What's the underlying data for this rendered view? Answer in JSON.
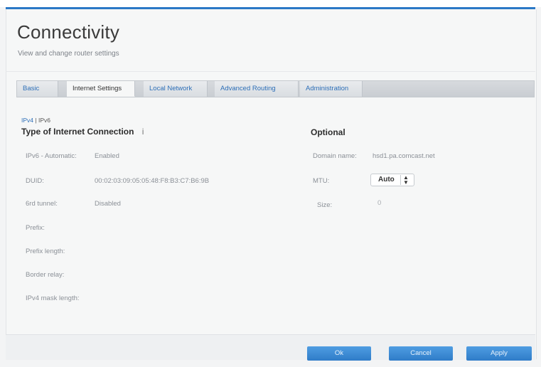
{
  "header": {
    "title": "Connectivity",
    "subtitle": "View and change router settings"
  },
  "tabs": [
    {
      "label": "Basic",
      "active": false
    },
    {
      "label": "Internet Settings",
      "active": true
    },
    {
      "label": "Local Network",
      "active": false
    },
    {
      "label": "Advanced Routing",
      "active": false
    },
    {
      "label": "Administration",
      "active": false
    }
  ],
  "breadcrumb": {
    "ipv4": "IPv4",
    "sep": "|",
    "ipv6": "IPv6"
  },
  "internet": {
    "heading": "Type of Internet Connection",
    "rows": [
      {
        "label": "IPv6 - Automatic:",
        "value": "Enabled"
      },
      {
        "label": "DUID:",
        "value": "00:02:03:09:05:05:48:F8:B3:C7:B6:9B"
      },
      {
        "label": "6rd tunnel:",
        "value": "Disabled"
      },
      {
        "label": "Prefix:",
        "value": ""
      },
      {
        "label": "Prefix length:",
        "value": ""
      },
      {
        "label": "Border relay:",
        "value": ""
      },
      {
        "label": "IPv4 mask length:",
        "value": ""
      }
    ]
  },
  "optional": {
    "heading": "Optional",
    "domain_label": "Domain name:",
    "domain_value": "hsd1.pa.comcast.net",
    "mtu_label": "MTU:",
    "mtu_value": "Auto",
    "size_label": "Size:",
    "size_value": "0"
  },
  "footer": {
    "ok": "Ok",
    "cancel": "Cancel",
    "apply": "Apply"
  },
  "colors": {
    "accent": "#2b78c6",
    "button": "#3a88d3"
  }
}
